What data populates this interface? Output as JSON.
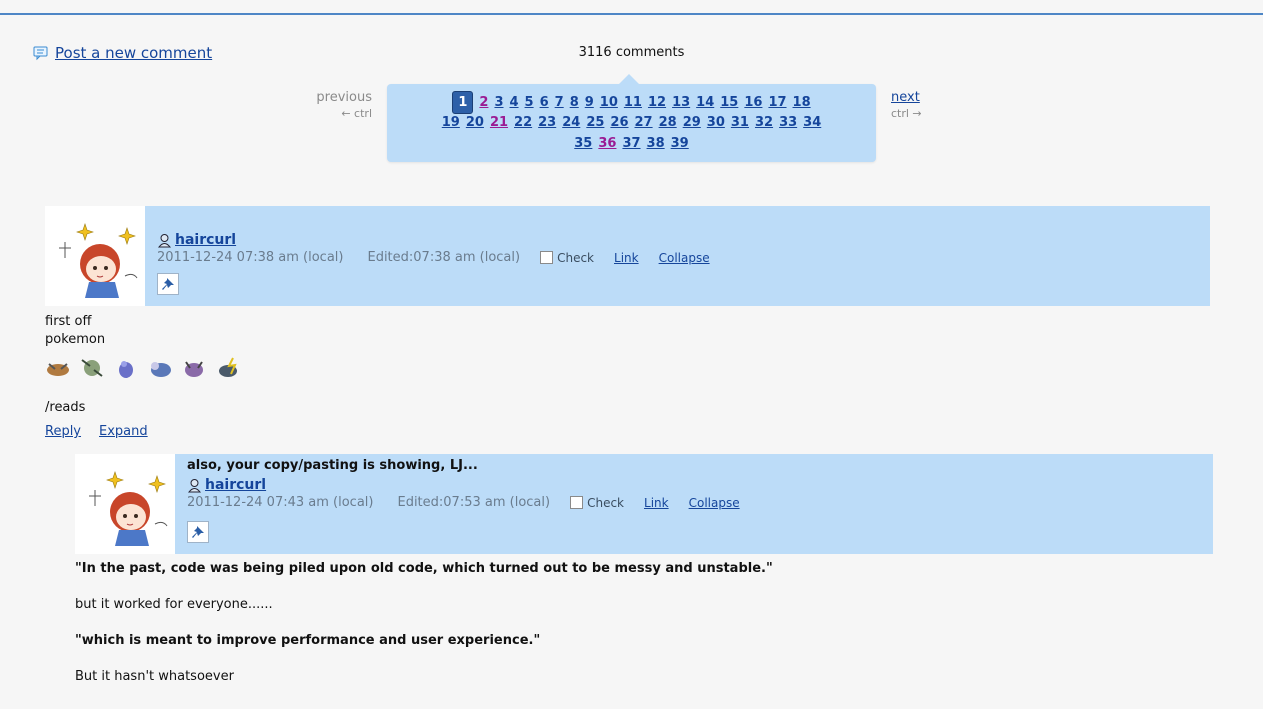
{
  "page": {
    "post_comment_label": "Post a new comment",
    "comment_count": "3116 comments"
  },
  "pager": {
    "previous_label": "previous",
    "previous_hint": "← ctrl",
    "next_label": "next",
    "next_hint": "ctrl →",
    "rows": [
      [
        "1",
        "2",
        "3",
        "4",
        "5",
        "6",
        "7",
        "8",
        "9",
        "10",
        "11",
        "12",
        "13",
        "14",
        "15",
        "16",
        "17",
        "18"
      ],
      [
        "19",
        "20",
        "21",
        "22",
        "23",
        "24",
        "25",
        "26",
        "27",
        "28",
        "29",
        "30",
        "31",
        "32",
        "33",
        "34"
      ],
      [
        "35",
        "36",
        "37",
        "38",
        "39"
      ]
    ],
    "current": "1",
    "visited": [
      "2",
      "21",
      "36"
    ]
  },
  "comment1": {
    "username": "haircurl",
    "date": "2011-12-24 07:38 am (local)",
    "edited": "Edited:07:38 am (local)",
    "check_label": "Check",
    "link_label": "Link",
    "collapse_label": "Collapse",
    "body_line1": "first off",
    "body_line2": "pokemon",
    "body_line3": "/reads",
    "reply_label": "Reply",
    "expand_label": "Expand"
  },
  "comment2": {
    "subject": "also, your copy/pasting is showing, LJ...",
    "username": "haircurl",
    "date": "2011-12-24 07:43 am (local)",
    "edited": "Edited:07:53 am (local)",
    "check_label": "Check",
    "link_label": "Link",
    "collapse_label": "Collapse",
    "quote1": "\"In the past, code was being piled upon old code, which turned out to be messy and unstable.\"",
    "text1": "but it worked for everyone......",
    "quote2": "\"which is meant to improve performance and user experience.\"",
    "text2": "But it hasn't whatsoever"
  },
  "colors": {
    "header_bg": "#bcdcf8",
    "link": "#15459b",
    "visited": "#9a1b93",
    "current_page": "#2d60a8"
  }
}
